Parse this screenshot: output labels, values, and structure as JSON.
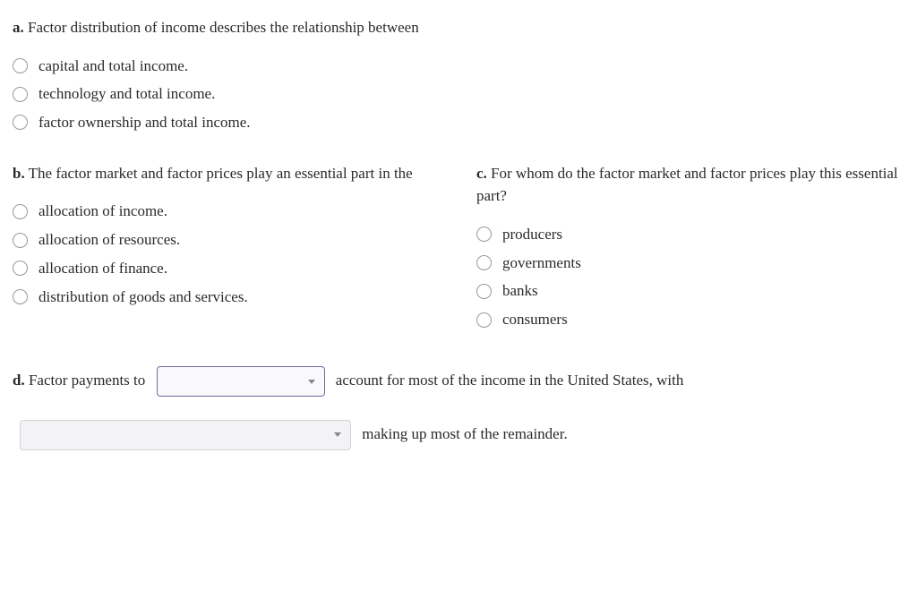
{
  "qa": {
    "prefix": "a.",
    "text": "Factor distribution of income describes the relationship between",
    "options": [
      "capital and total income.",
      "technology and total income.",
      "factor ownership and total income."
    ]
  },
  "qb": {
    "prefix": "b.",
    "text": "The factor market and factor prices play an essential part in the",
    "options": [
      "allocation of income.",
      "allocation of resources.",
      "allocation of finance.",
      "distribution of goods and services."
    ]
  },
  "qc": {
    "prefix": "c.",
    "text": "For whom do the factor market and factor prices play this essential part?",
    "options": [
      "producers",
      "governments",
      "banks",
      "consumers"
    ]
  },
  "qd": {
    "prefix": "d.",
    "text1_before": "Factor payments to",
    "text1_after": "account for most of the income in the United States, with",
    "text2_after": "making up most of the remainder."
  }
}
